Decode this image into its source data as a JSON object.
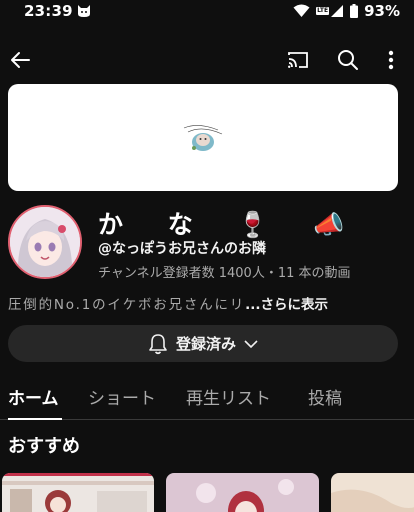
{
  "status_bar": {
    "time": "23:39",
    "battery": "93%",
    "network_label": "LTE"
  },
  "app_bar": {
    "icons": [
      "back-arrow-icon",
      "cast-icon",
      "search-icon",
      "more-vert-icon"
    ]
  },
  "channel": {
    "name": "か な 🍷 📣",
    "handle": "@なっぽうお兄さんのお隣",
    "stats": "チャンネル登録者数 1400人・11 本の動画",
    "description": "圧倒的No.1のイケボお兄さんにリ",
    "more_label": "...さらに表示"
  },
  "subscribe": {
    "label": "登録済み"
  },
  "tabs": [
    {
      "label": "ホーム",
      "active": true
    },
    {
      "label": "ショート",
      "active": false
    },
    {
      "label": "再生リスト",
      "active": false
    },
    {
      "label": "投稿",
      "active": false
    }
  ],
  "section": {
    "title": "おすすめ"
  },
  "colors": {
    "background": "#0f0f0f",
    "surface": "#272727",
    "text_primary": "#f1f1f1",
    "text_secondary": "#aaaaaa",
    "avatar_ring": "#e06070"
  }
}
